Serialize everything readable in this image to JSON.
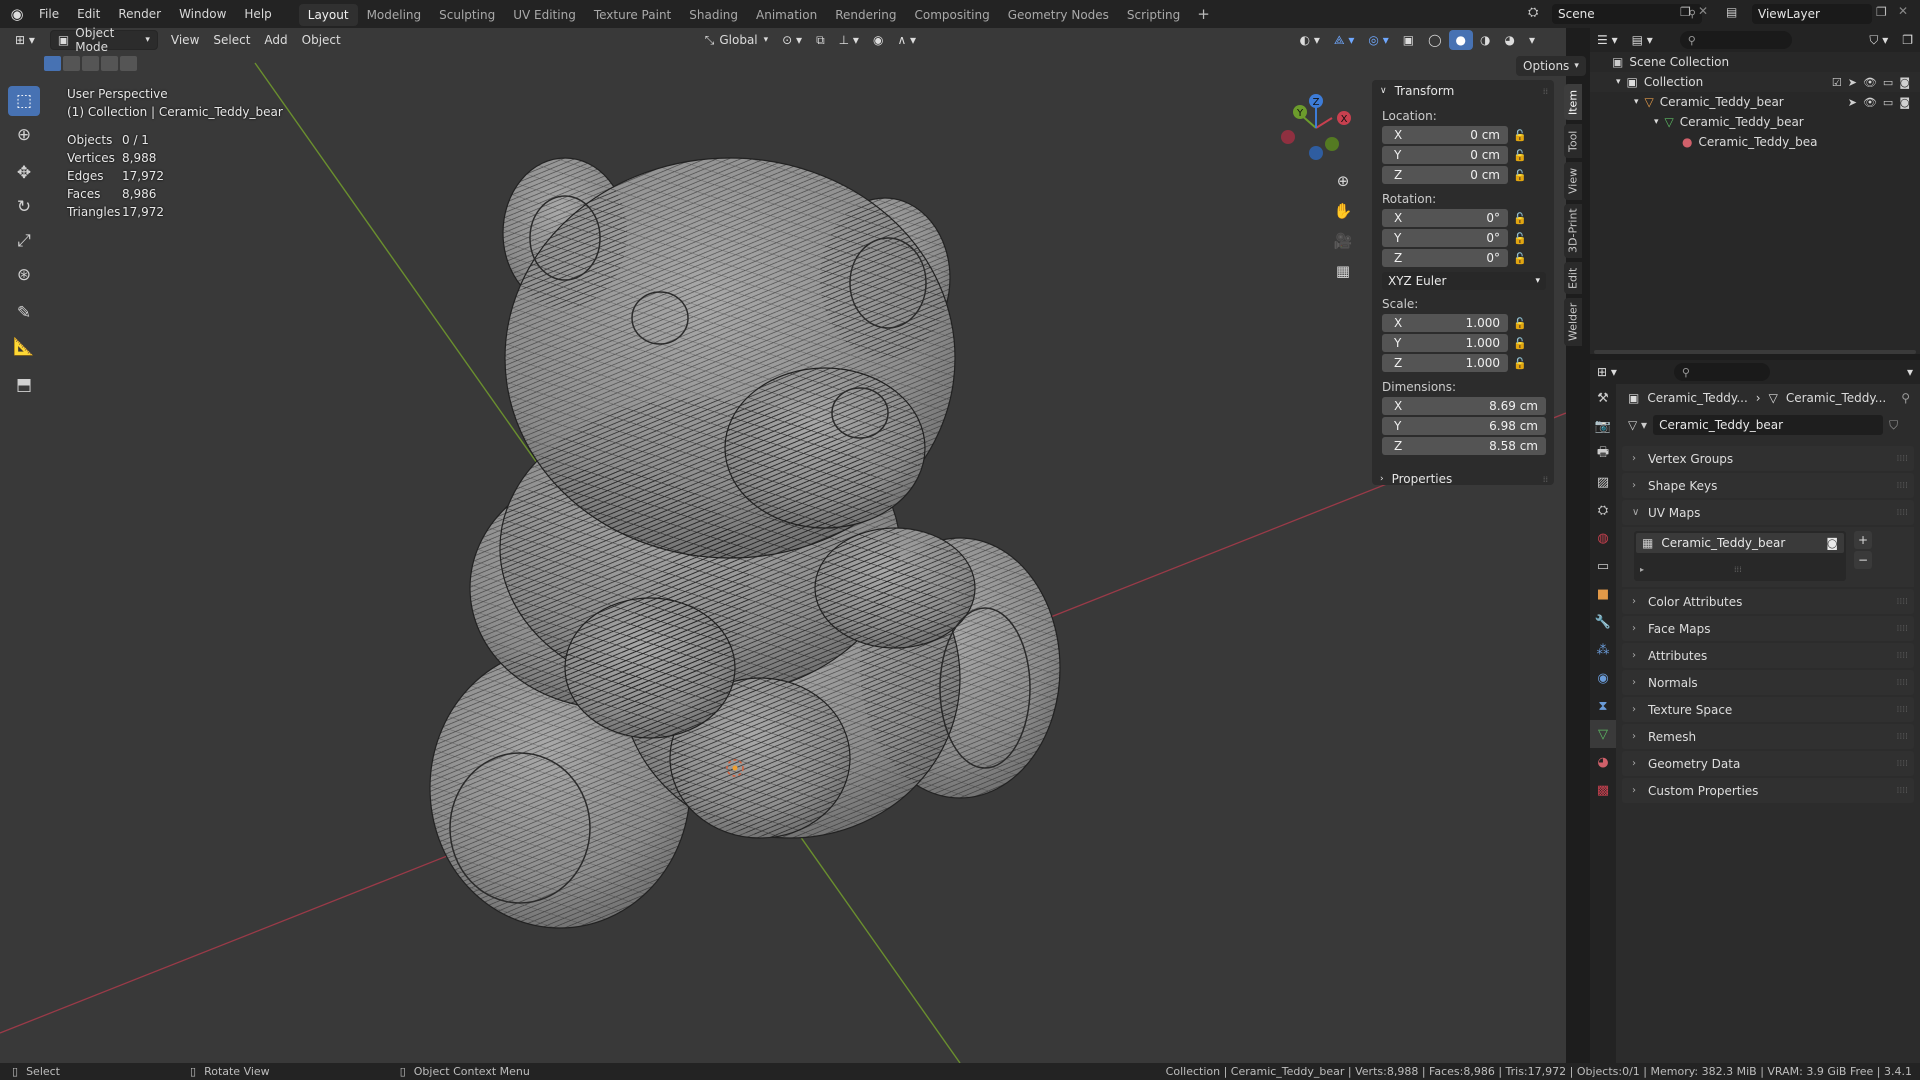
{
  "menu": [
    "File",
    "Edit",
    "Render",
    "Window",
    "Help"
  ],
  "workspaces": [
    {
      "label": "Layout",
      "active": true
    },
    {
      "label": "Modeling",
      "active": false
    },
    {
      "label": "Sculpting",
      "active": false
    },
    {
      "label": "UV Editing",
      "active": false
    },
    {
      "label": "Texture Paint",
      "active": false
    },
    {
      "label": "Shading",
      "active": false
    },
    {
      "label": "Animation",
      "active": false
    },
    {
      "label": "Rendering",
      "active": false
    },
    {
      "label": "Compositing",
      "active": false
    },
    {
      "label": "Geometry Nodes",
      "active": false
    },
    {
      "label": "Scripting",
      "active": false
    }
  ],
  "add_workspace": "+",
  "scene": "Scene",
  "view_layer": "ViewLayer",
  "viewport": {
    "mode": "Object Mode",
    "menus": [
      "View",
      "Select",
      "Add",
      "Object"
    ],
    "orientation": "Global",
    "options": "Options",
    "title": "User Perspective",
    "subtitle": "(1) Collection | Ceramic_Teddy_bear",
    "stats": [
      {
        "label": "Objects",
        "value": "0 / 1"
      },
      {
        "label": "Vertices",
        "value": "8,988"
      },
      {
        "label": "Edges",
        "value": "17,972"
      },
      {
        "label": "Faces",
        "value": "8,986"
      },
      {
        "label": "Triangles",
        "value": "17,972"
      }
    ],
    "gizmo_axes": [
      "X",
      "Y",
      "Z"
    ]
  },
  "npanel": {
    "transform_title": "Transform",
    "location_label": "Location:",
    "location": [
      {
        "axis": "X",
        "value": "0 cm"
      },
      {
        "axis": "Y",
        "value": "0 cm"
      },
      {
        "axis": "Z",
        "value": "0 cm"
      }
    ],
    "rotation_label": "Rotation:",
    "rotation": [
      {
        "axis": "X",
        "value": "0°"
      },
      {
        "axis": "Y",
        "value": "0°"
      },
      {
        "axis": "Z",
        "value": "0°"
      }
    ],
    "rotation_mode": "XYZ Euler",
    "scale_label": "Scale:",
    "scale": [
      {
        "axis": "X",
        "value": "1.000"
      },
      {
        "axis": "Y",
        "value": "1.000"
      },
      {
        "axis": "Z",
        "value": "1.000"
      }
    ],
    "dimensions_label": "Dimensions:",
    "dimensions": [
      {
        "axis": "X",
        "value": "8.69 cm"
      },
      {
        "axis": "Y",
        "value": "6.98 cm"
      },
      {
        "axis": "Z",
        "value": "8.58 cm"
      }
    ],
    "properties_title": "Properties",
    "tabs": [
      "Item",
      "Tool",
      "View",
      "3D-Print",
      "Edit",
      "Welder"
    ]
  },
  "outliner": {
    "rows": [
      "Scene Collection",
      "Collection",
      "Ceramic_Teddy_bear",
      "Ceramic_Teddy_bear",
      "Ceramic_Teddy_bea"
    ]
  },
  "properties": {
    "breadcrumb_object": "Ceramic_Teddy...",
    "breadcrumb_data": "Ceramic_Teddy...",
    "mesh_name": "Ceramic_Teddy_bear",
    "uv_map": "Ceramic_Teddy_bear",
    "sections": {
      "vertex_groups": "Vertex Groups",
      "shape_keys": "Shape Keys",
      "uv_maps": "UV Maps",
      "color_attributes": "Color Attributes",
      "face_maps": "Face Maps",
      "attributes": "Attributes",
      "normals": "Normals",
      "texture_space": "Texture Space",
      "remesh": "Remesh",
      "geometry_data": "Geometry Data",
      "custom_properties": "Custom Properties"
    },
    "colors": {
      "active_tab": "#4772b3",
      "data_tab": "#5dbb63"
    }
  },
  "statusbar": {
    "select": "Select",
    "rotate": "Rotate View",
    "context": "Object Context Menu",
    "info": "Collection | Ceramic_Teddy_bear | Verts:8,988 | Faces:8,986 | Tris:17,972 | Objects:0/1 | Memory: 382.3 MiB | VRAM: 3.9 GiB Free | 3.4.1"
  }
}
